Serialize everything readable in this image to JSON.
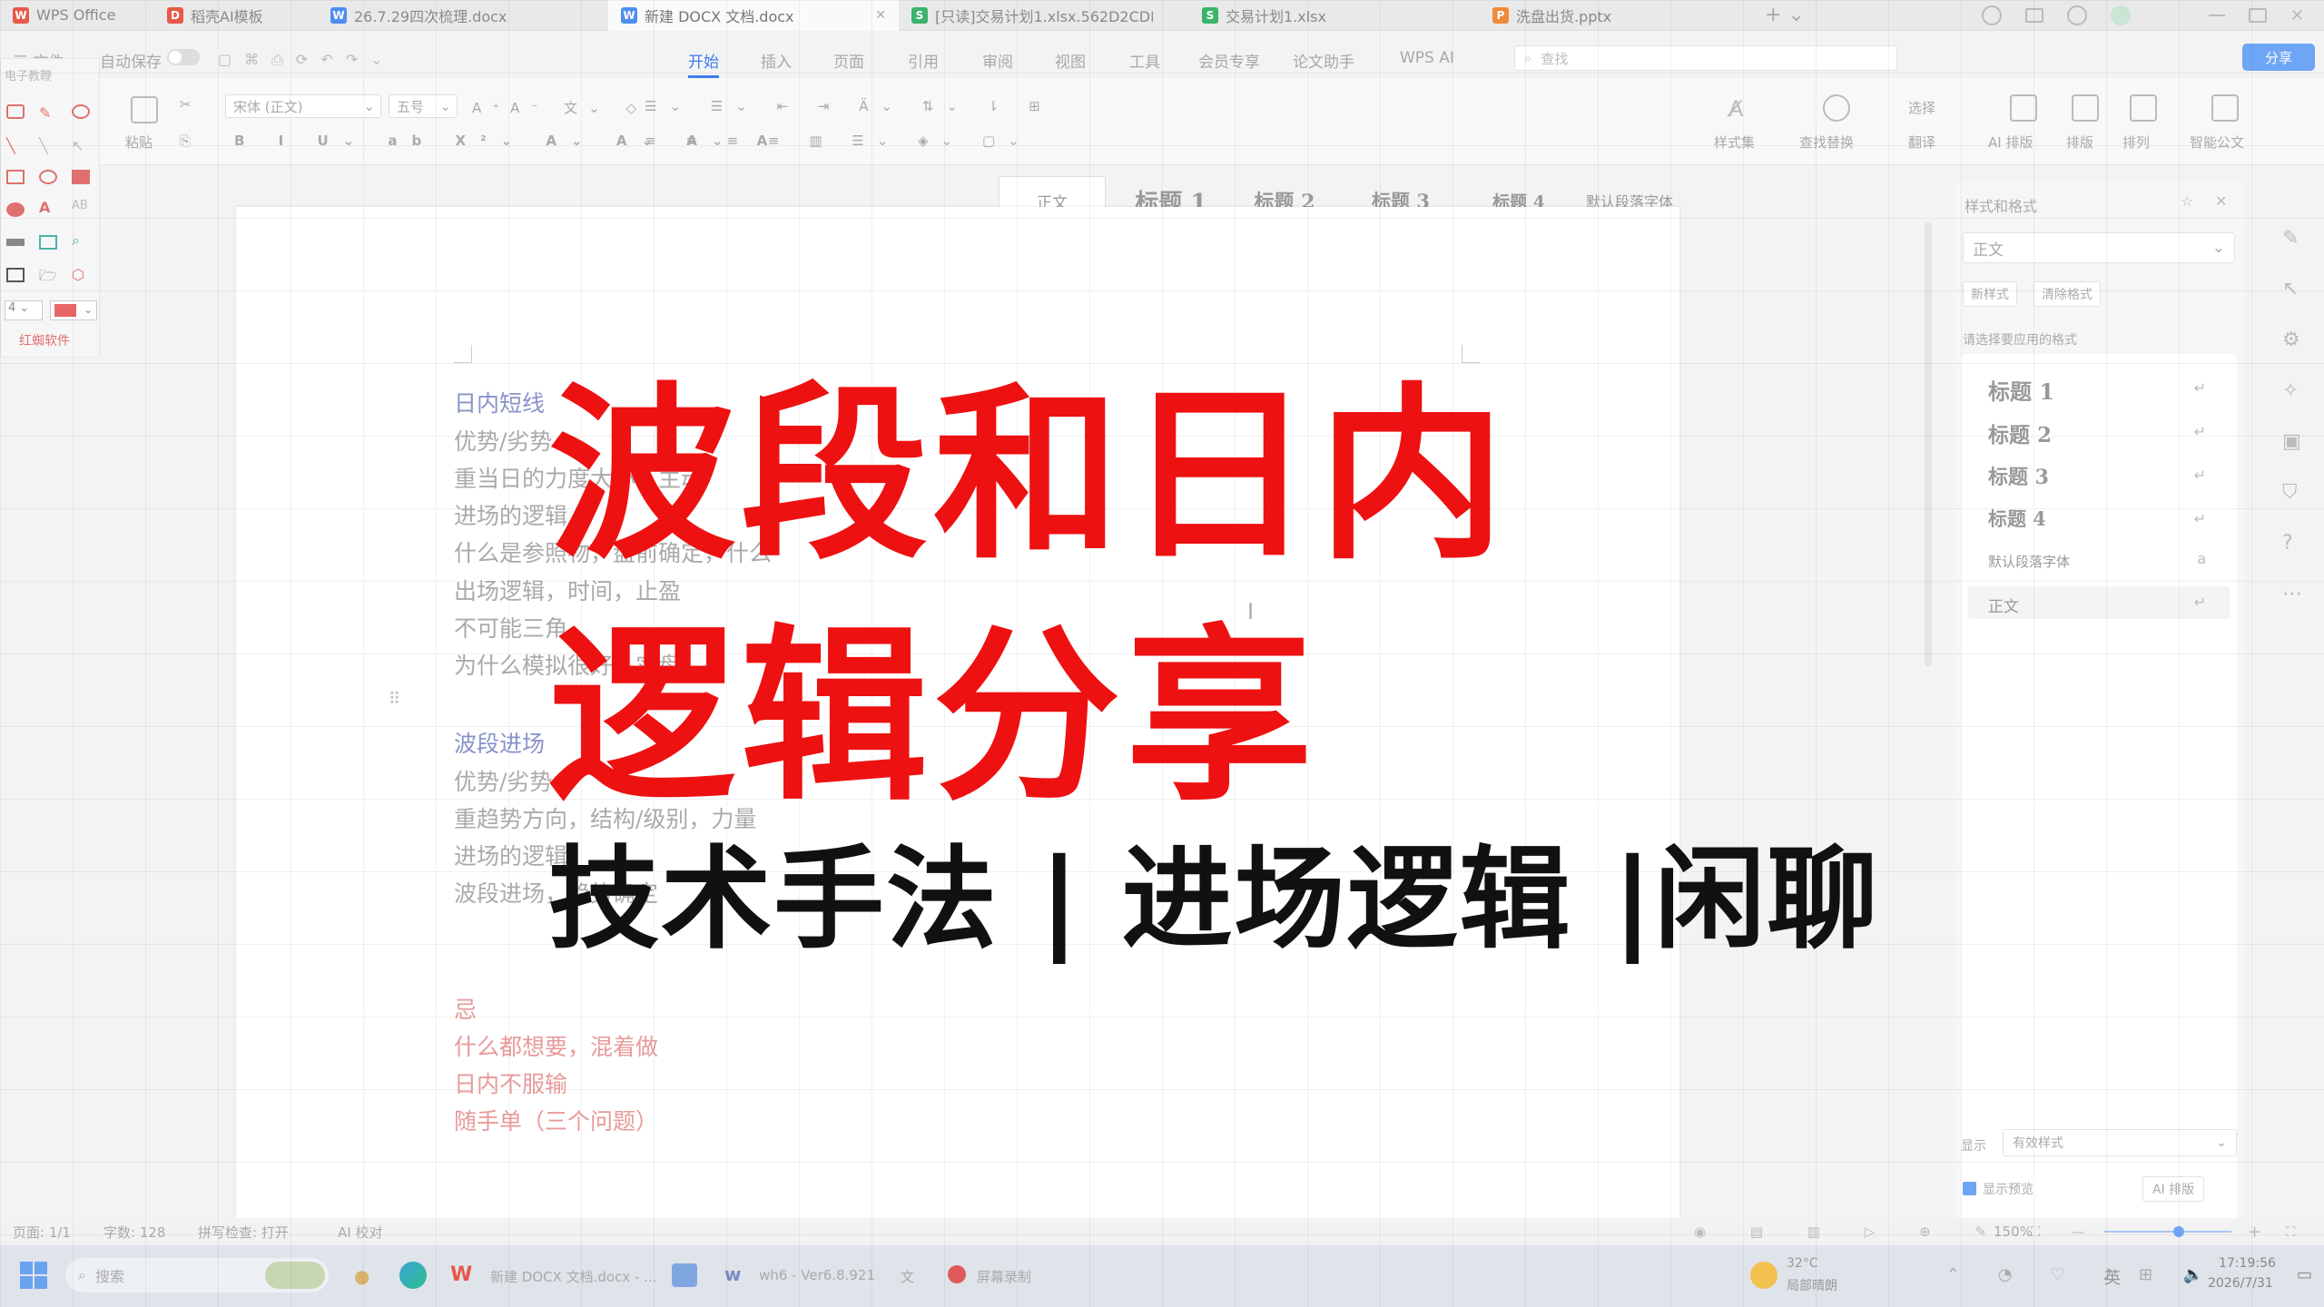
{
  "tabs": [
    {
      "label": "WPS Office",
      "icon": "wps-logo-icon",
      "color": "#e8584b"
    },
    {
      "label": "稻壳AI模板",
      "icon": "daoke-icon",
      "color": "#e8584b"
    },
    {
      "label": "26.7.29四次梳理.docx",
      "icon": "word-doc-icon",
      "color": "#4e8ef2"
    },
    {
      "label": "新建 DOCX 文档.docx",
      "icon": "word-doc-icon",
      "color": "#4e8ef2"
    },
    {
      "label": "[只读]交易计划1.xlsx.562D2CDE",
      "icon": "sheet-icon",
      "color": "#3bb36a"
    },
    {
      "label": "交易计划1.xlsx",
      "icon": "sheet-icon",
      "color": "#3bb36a"
    },
    {
      "label": "洗盘出货.pptx",
      "icon": "ppt-icon",
      "color": "#f08b3a"
    }
  ],
  "menu": {
    "file": "三 文件",
    "autosave": "自动保存",
    "items": [
      "开始",
      "插入",
      "页面",
      "引用",
      "审阅",
      "视图",
      "工具",
      "会员专享",
      "论文助手",
      "WPS AI"
    ],
    "active_index": 0,
    "search_placeholder": "查找",
    "share": "分享"
  },
  "ribbon": {
    "font_name": "宋体 (正文)",
    "font_size": "五号",
    "paste": "粘贴",
    "styles": [
      "正文",
      "标题 1",
      "标题 2",
      "标题 3",
      "标题 4",
      "默认段落字体"
    ],
    "style_gallery": "样式集",
    "find_replace": "查找替换",
    "select": "选择",
    "translate": "翻译",
    "ai_layout": "AI 排版",
    "layout": "排版",
    "arrange": "排列",
    "smart_doc": "智能公文"
  },
  "left_tools": {
    "title": "电子教鞭",
    "size_value": "4",
    "footer": "红蜘软件"
  },
  "document": {
    "lines": [
      {
        "text": "日内短线",
        "kind": "head"
      },
      {
        "text": "优势/劣势",
        "kind": "body"
      },
      {
        "text": "重当日的力度大小，主动",
        "kind": "body"
      },
      {
        "text": "进场的逻辑",
        "kind": "body"
      },
      {
        "text": "什么是参照物，盘前确定，什么",
        "kind": "body"
      },
      {
        "text": "出场逻辑，时间，止盈",
        "kind": "body"
      },
      {
        "text": "不可能三角",
        "kind": "body"
      },
      {
        "text": "为什么模拟很好，实盘",
        "kind": "body"
      },
      {
        "text": "波段进场",
        "kind": "head"
      },
      {
        "text": "优势/劣势",
        "kind": "body"
      },
      {
        "text": "重趋势方向，结构/级别，力量",
        "kind": "body"
      },
      {
        "text": "进场的逻辑",
        "kind": "body"
      },
      {
        "text": "波段进场，趋势确定",
        "kind": "body"
      },
      {
        "text": "忌",
        "kind": "red"
      },
      {
        "text": "什么都想要，混着做",
        "kind": "red"
      },
      {
        "text": "日内不服输",
        "kind": "red"
      },
      {
        "text": "随手单（三个问题）",
        "kind": "red"
      }
    ]
  },
  "style_pane": {
    "title": "样式和格式",
    "current": "正文",
    "new_style": "新样式",
    "clear_format": "清除格式",
    "hint": "请选择要应用的格式",
    "items": [
      "标题 1",
      "标题 2",
      "标题 3",
      "标题 4",
      "默认段落字体",
      "正文"
    ],
    "show_label": "显示",
    "show_value": "有效样式",
    "preview_label": "显示预览",
    "ai_btn": "AI 排版"
  },
  "status": {
    "page": "页面: 1/1",
    "words": "字数: 128",
    "spell": "拼写检查: 打开",
    "proof": "AI 校对",
    "zoom": "150%"
  },
  "taskbar": {
    "search": "搜索",
    "apps": [
      "新建 DOCX 文档.docx - ...",
      "wh6 - Ver6.8.921",
      "文",
      "屏幕录制"
    ],
    "weather_temp": "32°C",
    "weather_desc": "局部晴朗",
    "ime": "英",
    "time": "17:19:56",
    "date": "2026/7/31"
  },
  "overlay": {
    "title_line1": "波段和日内",
    "title_line2": "逻辑分享",
    "subtitle": "技术手法 | 进场逻辑 |闲聊",
    "title_color": "#ee1111",
    "subtitle_color": "#111111"
  }
}
